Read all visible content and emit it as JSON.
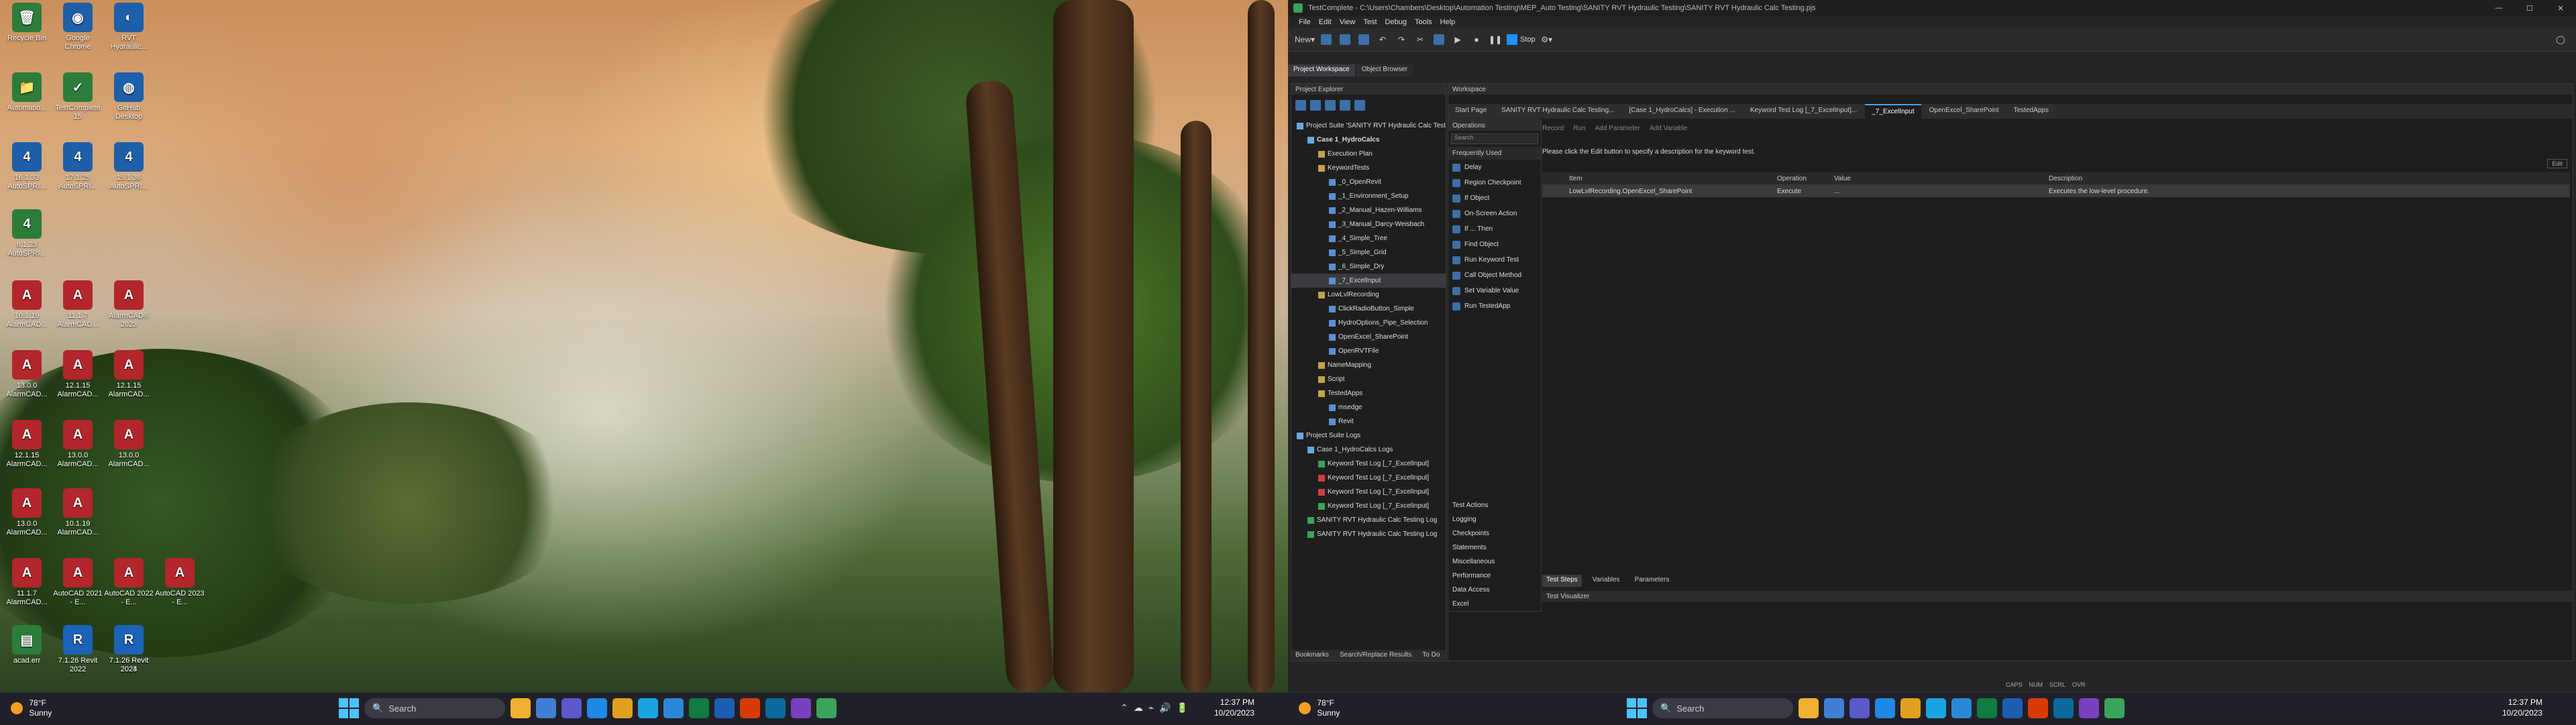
{
  "desktop": {
    "icons": [
      {
        "label": "Recycle Bin",
        "glyph": "🗑",
        "cls": "gr"
      },
      {
        "label": "Google Chrome",
        "glyph": "◉",
        "cls": "au"
      },
      {
        "label": "RVT Hydraulic...",
        "glyph": "◐",
        "cls": "au"
      },
      {
        "label": "Automatio...",
        "glyph": "📁",
        "cls": "gr"
      },
      {
        "label": "TestComplete 15",
        "glyph": "✓",
        "cls": "gr"
      },
      {
        "label": "GitHub Desktop",
        "glyph": "◍",
        "cls": "au"
      },
      {
        "label": "16.1.33 AutoSPRI...",
        "glyph": "4",
        "cls": "au"
      },
      {
        "label": "17.1.25 AutoSPRI...",
        "glyph": "4",
        "cls": "au"
      },
      {
        "label": "15.1.36 AutoSPRI...",
        "glyph": "4",
        "cls": "au"
      },
      {
        "label": "6.1.23 AutoSPRI...",
        "glyph": "4",
        "cls": "gr"
      },
      {
        "label": "10.1.19 AlarmCAD...",
        "glyph": "A",
        "cls": "ac"
      },
      {
        "label": "11.1.7 AlarmCAD...",
        "glyph": "A",
        "cls": "ac"
      },
      {
        "label": "AlarmCAD® 2023",
        "glyph": "A",
        "cls": "ac"
      },
      {
        "label": "13.0.0 AlarmCAD...",
        "glyph": "A",
        "cls": "ac"
      },
      {
        "label": "12.1.15 AlarmCAD...",
        "glyph": "A",
        "cls": "ac"
      },
      {
        "label": "12.1.15 AlarmCAD...",
        "glyph": "A",
        "cls": "ac"
      },
      {
        "label": "12.1.15 AlarmCAD...",
        "glyph": "A",
        "cls": "ac"
      },
      {
        "label": "13.0.0 AlarmCAD...",
        "glyph": "A",
        "cls": "ac"
      },
      {
        "label": "13.0.0 AlarmCAD...",
        "glyph": "A",
        "cls": "ac"
      },
      {
        "label": "13.0.0 AlarmCAD...",
        "glyph": "A",
        "cls": "ac"
      },
      {
        "label": "10.1.19 AlarmCAD...",
        "glyph": "A",
        "cls": "ac"
      },
      {
        "label": "11.1.7 AlarmCAD...",
        "glyph": "A",
        "cls": "ac"
      },
      {
        "label": "AutoCAD 2021 - E...",
        "glyph": "A",
        "cls": "ac"
      },
      {
        "label": "AutoCAD 2022 - E...",
        "glyph": "A",
        "cls": "ac"
      },
      {
        "label": "AutoCAD 2023 - E...",
        "glyph": "A",
        "cls": "ac"
      },
      {
        "label": "acad.err",
        "glyph": "▤",
        "cls": "gr"
      },
      {
        "label": "7.1.26 Revit 2022",
        "glyph": "R",
        "cls": "rv"
      },
      {
        "label": "7.1.26 Revit 2023",
        "glyph": "R",
        "cls": "rv"
      },
      {
        "label": "7.1.26 Revit 2024",
        "glyph": "R",
        "cls": "rv"
      }
    ]
  },
  "taskbar": {
    "weather_temp": "78°F",
    "weather_desc": "Sunny",
    "search_label": "Search",
    "time": "12:37 PM",
    "date": "10/20/2023"
  },
  "app": {
    "title": "TestComplete - C:\\Users\\Chambers\\Desktop\\Automation Testing\\MEP_Auto Testing\\SANITY RVT Hydraulic Testing\\SANITY RVT Hydraulic Calc Testing.pjs",
    "menus": [
      "File",
      "Edit",
      "View",
      "Test",
      "Debug",
      "Tools",
      "Help"
    ],
    "toolbar": {
      "new_label": "New",
      "stop_label": "Stop"
    },
    "workspace_tabs": [
      "Project Workspace",
      "Object Browser"
    ],
    "explorer_title": "Project Explorer",
    "workspace_title": "Workspace",
    "tree": [
      {
        "label": "Project Suite 'SANITY RVT Hydraulic Calc Testing'",
        "level": 0,
        "color": "#6aa8e0"
      },
      {
        "label": "Case 1_HydroCalcs",
        "level": 1,
        "color": "#6aa8e0",
        "bold": true
      },
      {
        "label": "Execution Plan",
        "level": 2,
        "color": "#c8a24a"
      },
      {
        "label": "KeywordTests",
        "level": 2,
        "color": "#c8a24a"
      },
      {
        "label": "_0_OpenRevit",
        "level": 3,
        "color": "#5b8fd0"
      },
      {
        "label": "_1_Environment_Setup",
        "level": 3,
        "color": "#5b8fd0"
      },
      {
        "label": "_2_Manual_Hazen-Williams",
        "level": 3,
        "color": "#5b8fd0"
      },
      {
        "label": "_3_Manual_Darcy-Weisbach",
        "level": 3,
        "color": "#5b8fd0"
      },
      {
        "label": "_4_Simple_Tree",
        "level": 3,
        "color": "#5b8fd0"
      },
      {
        "label": "_5_Simple_Grid",
        "level": 3,
        "color": "#5b8fd0"
      },
      {
        "label": "_6_Simple_Dry",
        "level": 3,
        "color": "#5b8fd0"
      },
      {
        "label": "_7_ExcelInput",
        "level": 3,
        "color": "#5b8fd0",
        "sel": true
      },
      {
        "label": "LowLvlRecording",
        "level": 2,
        "color": "#c8a24a"
      },
      {
        "label": "ClickRadioButton_Simple",
        "level": 3,
        "color": "#5b8fd0"
      },
      {
        "label": "HydroOptions_Pipe_Selection",
        "level": 3,
        "color": "#5b8fd0"
      },
      {
        "label": "OpenExcel_SharePoint",
        "level": 3,
        "color": "#5b8fd0"
      },
      {
        "label": "OpenRVTFile",
        "level": 3,
        "color": "#5b8fd0"
      },
      {
        "label": "NameMapping",
        "level": 2,
        "color": "#c8a24a"
      },
      {
        "label": "Script",
        "level": 2,
        "color": "#c8a24a"
      },
      {
        "label": "TestedApps",
        "level": 2,
        "color": "#c8a24a"
      },
      {
        "label": "msedge",
        "level": 3,
        "color": "#5b8fd0"
      },
      {
        "label": "Revit",
        "level": 3,
        "color": "#5b8fd0"
      },
      {
        "label": "Project Suite Logs",
        "level": 0,
        "color": "#6aa8e0"
      },
      {
        "label": "Case 1_HydroCalcs Logs",
        "level": 1,
        "color": "#6aa8e0"
      },
      {
        "label": "Keyword Test Log [_7_ExcelInput]",
        "level": 2,
        "color": "#3aa55a"
      },
      {
        "label": "Keyword Test Log [_7_ExcelInput]",
        "level": 2,
        "color": "#d04040"
      },
      {
        "label": "Keyword Test Log [_7_ExcelInput]",
        "level": 2,
        "color": "#d04040"
      },
      {
        "label": "Keyword Test Log [_7_ExcelInput]",
        "level": 2,
        "color": "#3aa55a"
      },
      {
        "label": "SANITY RVT Hydraulic Calc Testing Log",
        "level": 1,
        "color": "#3aa55a"
      },
      {
        "label": "SANITY RVT Hydraulic Calc Testing Log",
        "level": 1,
        "color": "#3aa55a"
      }
    ],
    "doc_tabs": [
      {
        "label": "Start Page"
      },
      {
        "label": "SANITY RVT Hydraulic Calc Testing..."
      },
      {
        "label": "[Case 1_HydroCalcs] - Execution ..."
      },
      {
        "label": "Keyword Test Log [_7_ExcelInput]..."
      },
      {
        "label": "_7_ExcelInput",
        "active": true
      },
      {
        "label": "OpenExcel_SharePoint"
      },
      {
        "label": "TestedApps"
      }
    ],
    "kw_toolbar": [
      "Record",
      "Run",
      "Add Parameter",
      "Add Variable"
    ],
    "operations": {
      "title": "Operations",
      "search_placeholder": "Search",
      "freq_title": "Frequently Used",
      "items": [
        "Delay",
        "Region Checkpoint",
        "If Object",
        "On-Screen Action",
        "If ... Then",
        "Find Object",
        "Run Keyword Test",
        "Call Object Method",
        "Set Variable Value",
        "Run TestedApp"
      ],
      "categories": [
        "Test Actions",
        "Logging",
        "Checkpoints",
        "Statements",
        "Miscellaneous",
        "Performance",
        "Data Access",
        "Excel"
      ]
    },
    "description_hint": "Please click the Edit button to specify a description for the keyword test.",
    "edit_label": "Edit",
    "grid": {
      "columns": [
        "Item",
        "Operation",
        "Value",
        "Description"
      ],
      "rows": [
        {
          "item": "LowLvlRecording.OpenExcel_SharePoint",
          "operation": "Execute",
          "value": "...",
          "description": "Executes the low-level procedure."
        }
      ]
    },
    "bottom_tabs": [
      "Test Steps",
      "Variables",
      "Parameters"
    ],
    "visualizer_label": "Test Visualizer",
    "explorer_bottom_tabs": [
      "Bookmarks",
      "Search/Replace Results",
      "To Do"
    ],
    "status": [
      "CAPS",
      "NUM",
      "SCRL",
      "OVR"
    ]
  },
  "colors": {
    "accent": "#3ea6ff",
    "bg": "#1e1e1e"
  }
}
